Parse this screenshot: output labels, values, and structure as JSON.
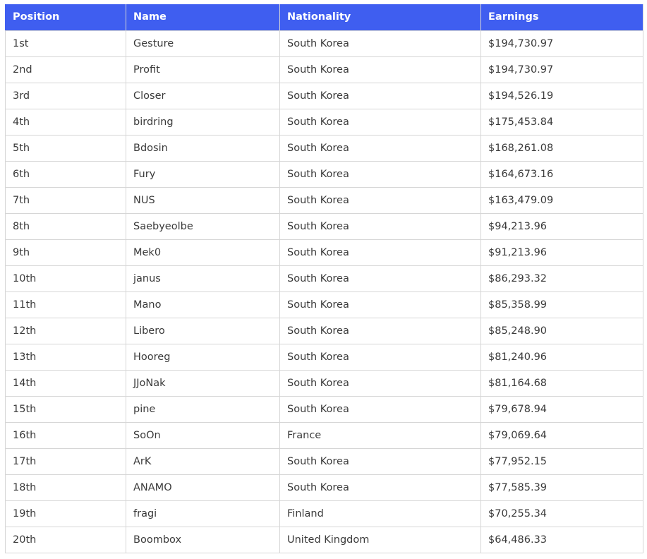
{
  "table": {
    "headers": [
      "Position",
      "Name",
      "Nationality",
      "Earnings"
    ],
    "rows": [
      [
        "1st",
        "Gesture",
        "South Korea",
        "$194,730.97"
      ],
      [
        "2nd",
        "Profit",
        "South Korea",
        "$194,730.97"
      ],
      [
        "3rd",
        "Closer",
        "South Korea",
        "$194,526.19"
      ],
      [
        "4th",
        "birdring",
        "South Korea",
        "$175,453.84"
      ],
      [
        "5th",
        "Bdosin",
        "South Korea",
        "$168,261.08"
      ],
      [
        "6th",
        "Fury",
        "South Korea",
        "$164,673.16"
      ],
      [
        "7th",
        "NUS",
        "South Korea",
        "$163,479.09"
      ],
      [
        "8th",
        "Saebyeolbe",
        "South Korea",
        "$94,213.96"
      ],
      [
        "9th",
        "Mek0",
        "South Korea",
        "$91,213.96"
      ],
      [
        "10th",
        "janus",
        "South Korea",
        "$86,293.32"
      ],
      [
        "11th",
        "Mano",
        "South Korea",
        "$85,358.99"
      ],
      [
        "12th",
        "Libero",
        "South Korea",
        "$85,248.90"
      ],
      [
        "13th",
        "Hooreg",
        "South Korea",
        "$81,240.96"
      ],
      [
        "14th",
        "JJoNak",
        "South Korea",
        "$81,164.68"
      ],
      [
        "15th",
        "pine",
        "South Korea",
        "$79,678.94"
      ],
      [
        "16th",
        "SoOn",
        "France",
        "$79,069.64"
      ],
      [
        "17th",
        "ArK",
        "South Korea",
        "$77,952.15"
      ],
      [
        "18th",
        "ANAMO",
        "South Korea",
        "$77,585.39"
      ],
      [
        "19th",
        "fragi",
        "Finland",
        "$70,255.34"
      ],
      [
        "20th",
        "Boombox",
        "United Kingdom",
        "$64,486.33"
      ]
    ]
  },
  "colors": {
    "header_bg": "#3f5ef0",
    "header_text": "#ffffff",
    "border": "#d6d6d6",
    "cell_text": "#3a3a3a"
  }
}
